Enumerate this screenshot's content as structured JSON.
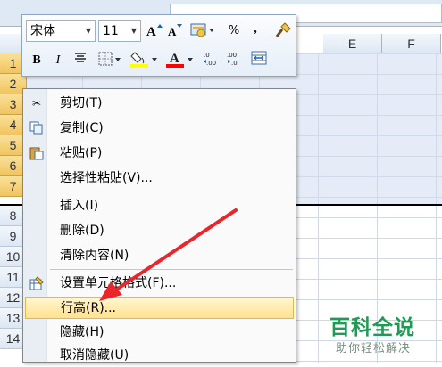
{
  "spreadsheet": {
    "columns": [
      {
        "label": "",
        "selected": true
      },
      {
        "label": "",
        "selected": true
      },
      {
        "label": "",
        "selected": true
      },
      {
        "label": "",
        "selected": true
      },
      {
        "label": "E",
        "selected": false
      },
      {
        "label": "F",
        "selected": false
      }
    ],
    "rows": [
      "1",
      "2",
      "3",
      "4",
      "5",
      "6",
      "7",
      "8",
      "9",
      "10",
      "11",
      "12",
      "13",
      "14"
    ],
    "selected_rows": 7
  },
  "mini_toolbar": {
    "font_name": "宋体",
    "font_size": "11",
    "grow_font_icon": "grow-font-icon",
    "shrink_font_icon": "shrink-font-icon",
    "accounting_icon": "accounting-format-icon",
    "percent": "%",
    "comma": ",",
    "bold": "B",
    "italic": "I",
    "fill_color": "#ffff00",
    "font_color": "#ff0000",
    "font_color_letter": "A"
  },
  "context_menu": {
    "items": [
      {
        "label": "剪切(T)",
        "icon": "scissors-icon"
      },
      {
        "label": "复制(C)",
        "icon": "copy-icon"
      },
      {
        "label": "粘贴(P)",
        "icon": "paste-icon"
      },
      {
        "label": "选择性粘贴(V)...",
        "icon": ""
      },
      {
        "label": "插入(I)",
        "icon": ""
      },
      {
        "label": "删除(D)",
        "icon": ""
      },
      {
        "label": "清除内容(N)",
        "icon": ""
      },
      {
        "label": "设置单元格格式(F)...",
        "icon": "format-cells-icon"
      },
      {
        "label": "行高(R)...",
        "icon": "",
        "highlighted": true
      },
      {
        "label": "隐藏(H)",
        "icon": ""
      },
      {
        "label": "取消隐藏(U)",
        "icon": ""
      }
    ]
  },
  "annotation": {
    "arrow_color": "#e8262b"
  },
  "watermark": {
    "title": "百科全说",
    "subtitle": "助你轻松解决"
  }
}
